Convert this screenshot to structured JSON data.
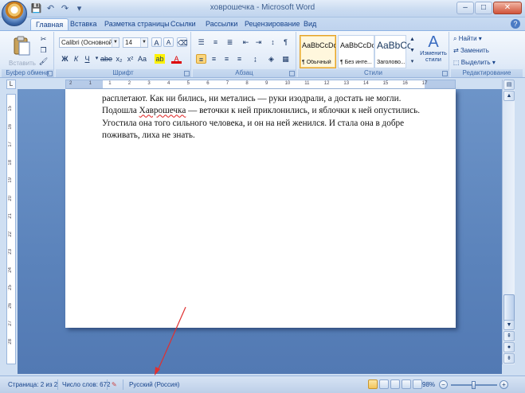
{
  "window": {
    "title": "ховрошечка - Microsoft Word",
    "buttons": [
      "–",
      "□",
      "✕"
    ]
  },
  "qat": [
    "💾",
    "↶",
    "↷",
    "▾"
  ],
  "tabs": [
    {
      "label": "Главная",
      "active": true
    },
    {
      "label": "Вставка"
    },
    {
      "label": "Разметка страницы"
    },
    {
      "label": "Ссылки"
    },
    {
      "label": "Рассылки"
    },
    {
      "label": "Рецензирование"
    },
    {
      "label": "Вид"
    }
  ],
  "ribbon": {
    "clipboard": {
      "label": "Буфер обмена",
      "paste_label": "Вставить"
    },
    "font": {
      "label": "Шрифт",
      "font_name": "Calibri (Основной те",
      "font_size": "14"
    },
    "paragraph": {
      "label": "Абзац"
    },
    "styles": {
      "label": "Стили",
      "tiles": [
        {
          "sample": "AaBbCcDc",
          "name": "¶ Обычный",
          "selected": true
        },
        {
          "sample": "AaBbCcDc",
          "name": "¶ Без инте..."
        },
        {
          "sample": "AaBbCc",
          "name": "Заголово..."
        }
      ],
      "change_label": "Изменить стили"
    },
    "editing": {
      "label": "Редактирование",
      "find": "Найти",
      "replace": "Заменить",
      "select": "Выделить"
    }
  },
  "ruler": {
    "numbers": [
      "2",
      "1",
      "1",
      "2",
      "3",
      "4",
      "5",
      "6",
      "7",
      "8",
      "9",
      "10",
      "11",
      "12",
      "13",
      "14",
      "15",
      "16",
      "17"
    ],
    "vnumbers": [
      "15",
      "16",
      "17",
      "18",
      "19",
      "20",
      "21",
      "22",
      "23",
      "24",
      "25",
      "26",
      "27",
      "28"
    ]
  },
  "document": {
    "line1": "расплетают. Как ни бились, ни метались — руки изодрали, а достать не могли.",
    "line2_a": "Подошла ",
    "line2_word": "Хаврошечка",
    "line2_b": " — веточки к ней приклонились, и яблочки к ней опустились.",
    "line3": "Угостила она того сильного человека, и он на ней женился. И стала она в добре",
    "line4": "поживать, лиха не знать."
  },
  "statusbar": {
    "page": "Страница: 2 из 2",
    "words": "Число слов: 672",
    "language": "Русский (Россия)",
    "zoom": "98%",
    "zoom_level_percent": 98
  },
  "colors": {
    "annotation_arrow": "#e03030",
    "accent": "#15428b"
  }
}
